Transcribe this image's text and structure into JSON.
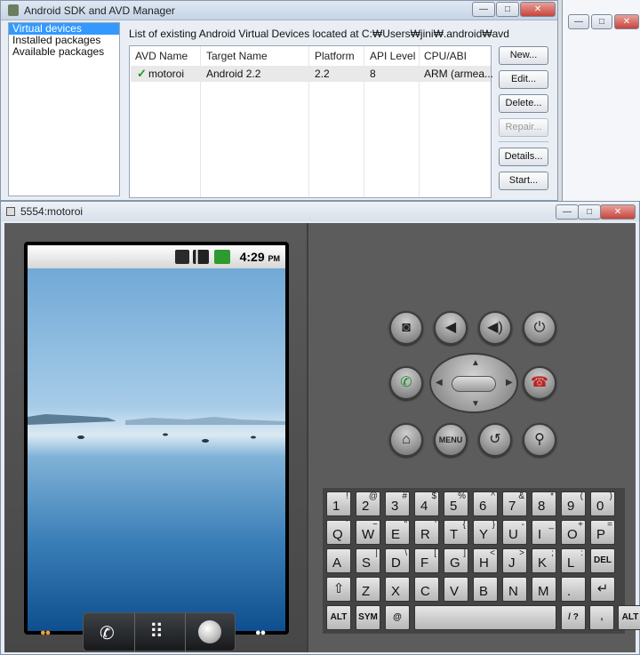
{
  "sdk_manager": {
    "title": "Android SDK and AVD Manager",
    "nav": [
      "Virtual devices",
      "Installed packages",
      "Available packages"
    ],
    "caption": "List of existing Android Virtual Devices located at C:₩Users₩jini₩.android₩avd",
    "columns": [
      "AVD Name",
      "Target Name",
      "Platform",
      "API Level",
      "CPU/ABI"
    ],
    "rows": [
      {
        "name": "motoroi",
        "target": "Android 2.2",
        "platform": "2.2",
        "api": "8",
        "cpu": "ARM (armea..."
      }
    ],
    "buttons": {
      "new": "New...",
      "edit": "Edit...",
      "delete": "Delete...",
      "repair": "Repair...",
      "details": "Details...",
      "start": "Start..."
    }
  },
  "emulator": {
    "title": "5554:motoroi",
    "status_time": "4:29",
    "status_ampm": "PM",
    "keys": {
      "menu": "MENU",
      "row1": [
        [
          "1",
          "!"
        ],
        [
          "2",
          "@"
        ],
        [
          "3",
          "#"
        ],
        [
          "4",
          "$"
        ],
        [
          "5",
          "%"
        ],
        [
          "6",
          "^"
        ],
        [
          "7",
          "&"
        ],
        [
          "8",
          "*"
        ],
        [
          "9",
          "("
        ],
        [
          "0",
          ")"
        ]
      ],
      "row2": [
        [
          "Q",
          "`"
        ],
        [
          "W",
          "~"
        ],
        [
          "E",
          "\""
        ],
        [
          "R",
          "'"
        ],
        [
          "T",
          "{"
        ],
        [
          "Y",
          "}"
        ],
        [
          "U",
          "-"
        ],
        [
          "I",
          "_"
        ],
        [
          "O",
          "+"
        ],
        [
          "P",
          "="
        ]
      ],
      "row3": [
        [
          "A",
          ""
        ],
        [
          "S",
          "|"
        ],
        [
          "D",
          "\\"
        ],
        [
          "F",
          "["
        ],
        [
          "G",
          "]"
        ],
        [
          "H",
          "<"
        ],
        [
          "J",
          ">"
        ],
        [
          "K",
          ";"
        ],
        [
          "L",
          ":"
        ],
        [
          "DEL",
          ""
        ]
      ],
      "row4": [
        [
          "",
          ""
        ],
        [
          "Z",
          ""
        ],
        [
          "X",
          ""
        ],
        [
          "C",
          ""
        ],
        [
          "V",
          ""
        ],
        [
          "B",
          ""
        ],
        [
          "N",
          ""
        ],
        [
          "M",
          ""
        ],
        [
          ".",
          ""
        ],
        [
          "",
          ""
        ]
      ],
      "alt": "ALT",
      "sym": "SYM",
      "at": "@",
      "slash": "/",
      "question": "?",
      "comma": ","
    }
  }
}
